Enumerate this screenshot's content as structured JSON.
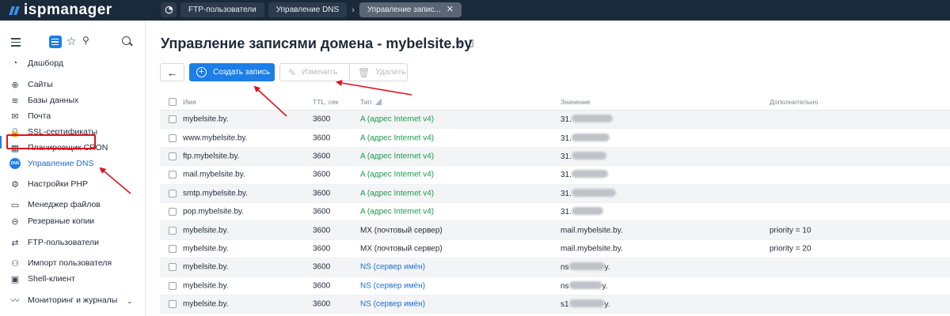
{
  "header": {
    "logo_text": "ispmanager",
    "breadcrumbs": [
      "FTP-пользователи",
      "Управление DNS",
      "Управление запис..."
    ],
    "close_glyph": "✕"
  },
  "sidebar": {
    "items": [
      {
        "label": "Дашборд",
        "icon": "dashboard-icon"
      },
      {
        "label": "Сайты",
        "icon": "globe-icon"
      },
      {
        "label": "Базы данных",
        "icon": "database-icon"
      },
      {
        "label": "Почта",
        "icon": "mail-icon"
      },
      {
        "label": "SSL-сертификаты",
        "icon": "lock-icon"
      },
      {
        "label": "Планировщик CRON",
        "icon": "calendar-icon"
      },
      {
        "label": "Управление DNS",
        "icon": "dns-icon",
        "active": true,
        "icon_text": "DNS"
      },
      {
        "label": "Настройки PHP",
        "icon": "php-icon"
      },
      {
        "label": "Менеджер файлов",
        "icon": "folder-icon"
      },
      {
        "label": "Резервные копии",
        "icon": "backup-icon"
      },
      {
        "label": "FTP-пользователи",
        "icon": "ftp-icon"
      },
      {
        "label": "Импорт пользователя",
        "icon": "user-import-icon"
      },
      {
        "label": "Shell-клиент",
        "icon": "terminal-icon"
      },
      {
        "label": "Мониторинг и журналы",
        "icon": "monitoring-icon"
      }
    ]
  },
  "page": {
    "title": "Управление записями домена - mybelsite.by",
    "create_label": "Создать запись",
    "edit_label": "Изменить",
    "delete_label": "Удалить",
    "back_glyph": "←"
  },
  "table": {
    "columns": [
      "Имя",
      "TTL, сек",
      "Тип",
      "Значение",
      "Дополнительно"
    ],
    "rows": [
      {
        "name": "mybelsite.by.",
        "ttl": "3600",
        "type": "A (адрес Internet v4)",
        "kind": "a",
        "value_prefix": "31.",
        "value_suffix": "",
        "extra": ""
      },
      {
        "name": "www.mybelsite.by.",
        "ttl": "3600",
        "type": "A (адрес Internet v4)",
        "kind": "a",
        "value_prefix": "31.",
        "value_suffix": "",
        "extra": ""
      },
      {
        "name": "ftp.mybelsite.by.",
        "ttl": "3600",
        "type": "A (адрес Internet v4)",
        "kind": "a",
        "value_prefix": "31.",
        "value_suffix": "",
        "extra": ""
      },
      {
        "name": "mail.mybelsite.by.",
        "ttl": "3600",
        "type": "A (адрес Internet v4)",
        "kind": "a",
        "value_prefix": "31.",
        "value_suffix": "",
        "extra": ""
      },
      {
        "name": "smtp.mybelsite.by.",
        "ttl": "3600",
        "type": "A (адрес Internet v4)",
        "kind": "a",
        "value_prefix": "31.",
        "value_suffix": "",
        "extra": ""
      },
      {
        "name": "pop.mybelsite.by.",
        "ttl": "3600",
        "type": "A (адрес Internet v4)",
        "kind": "a",
        "value_prefix": "31.",
        "value_suffix": "",
        "extra": ""
      },
      {
        "name": "mybelsite.by.",
        "ttl": "3600",
        "type": "MX (почтовый сервер)",
        "kind": "mx",
        "value_prefix": "mail.mybelsite.by.",
        "value_suffix": "",
        "extra": "priority = 10"
      },
      {
        "name": "mybelsite.by.",
        "ttl": "3600",
        "type": "MX (почтовый сервер)",
        "kind": "mx",
        "value_prefix": "mail.mybelsite.by.",
        "value_suffix": "",
        "extra": "priority = 20"
      },
      {
        "name": "mybelsite.by.",
        "ttl": "3600",
        "type": "NS (сервер имён)",
        "kind": "ns",
        "value_prefix": "ns",
        "value_suffix": "y.",
        "extra": ""
      },
      {
        "name": "mybelsite.by.",
        "ttl": "3600",
        "type": "NS (сервер имён)",
        "kind": "ns",
        "value_prefix": "ns",
        "value_suffix": "y.",
        "extra": ""
      },
      {
        "name": "mybelsite.by.",
        "ttl": "3600",
        "type": "NS (сервер имён)",
        "kind": "ns",
        "value_prefix": "s1",
        "value_suffix": "y.",
        "extra": ""
      }
    ]
  },
  "colors": {
    "topbar": "#1b2a3b",
    "accent": "#1c7ee6",
    "type_a": "#1a9a4a",
    "type_ns": "#1c6fd4",
    "annotation": "#e0111b"
  }
}
